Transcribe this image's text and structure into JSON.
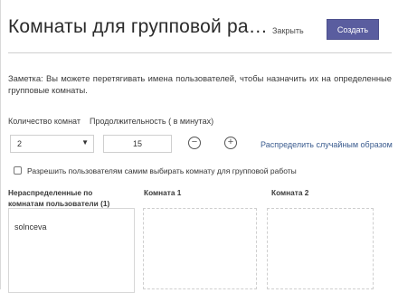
{
  "dialog": {
    "title": "Комнаты для групповой ра…",
    "close_label": "Закрыть",
    "create_label": "Создать"
  },
  "note": "Заметка: Вы можете перетягивать имена пользователей, чтобы назначить их на определенные групповые комнаты.",
  "settings": {
    "rooms_count_label": "Количество комнат",
    "rooms_count_value": "2",
    "duration_label": "Продолжительность ( в минутах)",
    "duration_value": "15",
    "decrement_symbol": "−",
    "increment_symbol": "+",
    "random_assign_label": "Распределить случайным образом"
  },
  "allow_choose": {
    "checked": false,
    "label": "Разрешить пользователям самим выбирать комнату для групповой работы"
  },
  "columns": {
    "unassigned": {
      "header": "Нераспределенные по комнатам пользователи (1)",
      "users": [
        "solnceva"
      ]
    },
    "room1": {
      "header": "Комната 1"
    },
    "room2": {
      "header": "Комната 2"
    }
  },
  "colors": {
    "accent": "#5a5d9f",
    "link": "#3b5c8f"
  }
}
